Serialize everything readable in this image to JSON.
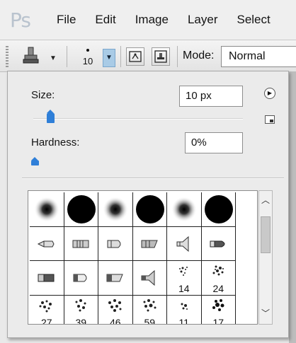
{
  "menubar": {
    "logo": "Ps",
    "items": [
      "File",
      "Edit",
      "Image",
      "Layer",
      "Select"
    ]
  },
  "options_bar": {
    "brush_size_number": "10",
    "mode_label": "Mode:",
    "mode_value": "Normal"
  },
  "brush_panel": {
    "size_label": "Size:",
    "size_value": "10 px",
    "size_slider_fraction": 0.05,
    "hardness_label": "Hardness:",
    "hardness_value": "0%",
    "hardness_slider_fraction": 0.0,
    "presets_row4_labels": [
      "27",
      "39",
      "46",
      "59",
      "11",
      "17"
    ],
    "presets_row3_labels": [
      "",
      "",
      "",
      "",
      "14",
      "24"
    ]
  },
  "colors": {
    "accent": "#2f7fd8",
    "dropdown_highlight": "#a9cbe6",
    "logo": "#b9c3ce"
  }
}
